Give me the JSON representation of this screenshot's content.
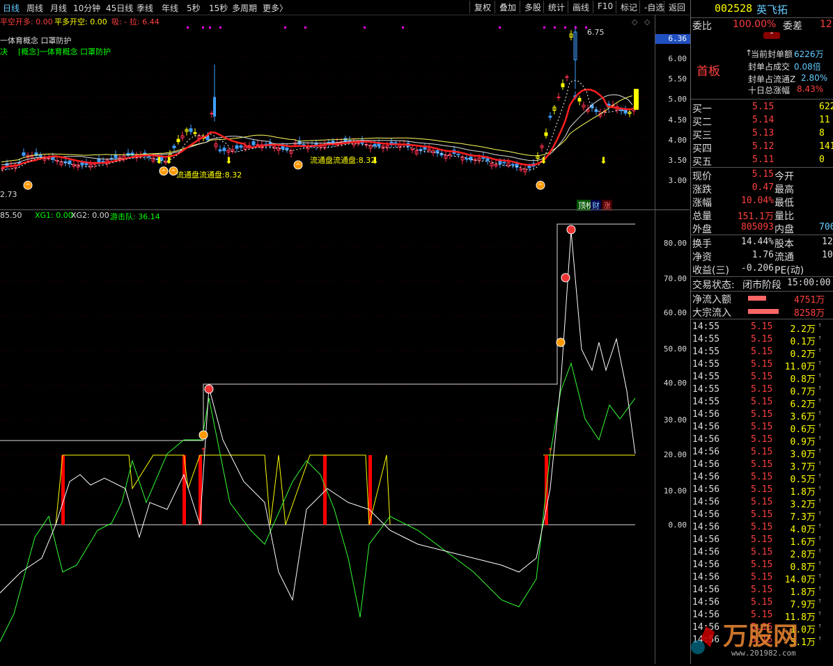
{
  "topbar": {
    "tabs": [
      "日线",
      "周线",
      "月线",
      "10分钟",
      "45日线",
      "季线",
      "年线",
      "5秒",
      "15秒",
      "多周期",
      "更多〉"
    ],
    "buttons": [
      "复权",
      "叠加",
      "多股",
      "统计",
      "画线",
      "F10",
      "标记",
      "-自选",
      "返回"
    ]
  },
  "main_chart": {
    "indicator_line": {
      "label1": "平空开多: 0.00",
      "label2": "平多开空: 0.00",
      "label3": "吸: -",
      "label4": "拉: 6.44"
    },
    "concept1": "一体育概念 口罩防护",
    "concept2_prefix": "决",
    "concept2": "[概念]一体育概念 口罩防护",
    "yticks": [
      "6.36",
      "6.00",
      "5.50",
      "5.00",
      "4.50",
      "4.00",
      "3.50",
      "3.00"
    ],
    "high_label": "6.75",
    "low_label": "2.73",
    "annot1": "流通盘流通盘:8.32",
    "annot2": "流通盘流通盘:8.32",
    "badges": [
      "顶榜",
      "财",
      "涨"
    ]
  },
  "sub_chart": {
    "indicator": {
      "v1": "85.50",
      "xg1": "XG1: 0.00",
      "xg2": "XG2: 0.00",
      "yjd": "游击队: 36.14"
    },
    "yticks": [
      "80.00",
      "70.00",
      "60.00",
      "50.00",
      "40.00",
      "30.00",
      "20.00",
      "10.00",
      "0.00"
    ]
  },
  "chart_data": {
    "type": "line",
    "title": "",
    "price_range": [
      2.73,
      6.75
    ],
    "indicator_range": [
      0,
      85.5
    ],
    "last_values": {
      "price": 5.15,
      "indicator": 36.14
    }
  },
  "stock": {
    "code": "002528",
    "name": "英飞拓",
    "weibi_label": "委比",
    "weibi_value": "100.00%",
    "weicha_label": "委差",
    "weicha_value": "12",
    "board_label": "首板",
    "seal_info": [
      {
        "label": "当前封单额",
        "value": "6226万"
      },
      {
        "label": "封单占成交",
        "value": "0.08倍"
      },
      {
        "label": "封单占流通Z",
        "value": "2.80%"
      },
      {
        "label": "十日总涨幅",
        "value": "8.43%"
      }
    ],
    "bids": [
      {
        "label": "买一",
        "price": "5.15",
        "vol": "622"
      },
      {
        "label": "买二",
        "price": "5.14",
        "vol": "11"
      },
      {
        "label": "买三",
        "price": "5.13",
        "vol": "8"
      },
      {
        "label": "买四",
        "price": "5.12",
        "vol": "141"
      },
      {
        "label": "买五",
        "price": "5.11",
        "vol": "0"
      }
    ],
    "quote": [
      {
        "l1": "现价",
        "v1": "5.15",
        "l2": "今开",
        "v2": ""
      },
      {
        "l1": "涨跌",
        "v1": "0.47",
        "l2": "最高",
        "v2": ""
      },
      {
        "l1": "涨幅",
        "v1": "10.04%",
        "l2": "最低",
        "v2": ""
      },
      {
        "l1": "总量",
        "v1": "151.1万",
        "l2": "量比",
        "v2": ""
      },
      {
        "l1": "外盘",
        "v1": "805093",
        "l2": "内盘",
        "v2": "706"
      }
    ],
    "finance": [
      {
        "l1": "换手",
        "v1": "14.44%",
        "l2": "股本",
        "v2": "12"
      },
      {
        "l1": "净资",
        "v1": "1.76",
        "l2": "流通",
        "v2": "10"
      },
      {
        "l1": "收益(三)",
        "v1": "-0.206",
        "l2": "PE(动)",
        "v2": ""
      }
    ],
    "status_label": "交易状态:",
    "status_value": "闭市阶段",
    "status_time": "15:00:00",
    "flows": [
      {
        "label": "净流入额",
        "value": "4751万",
        "level": 0.6
      },
      {
        "label": "大宗流入",
        "value": "8258万",
        "level": 1.0
      }
    ],
    "ticks": [
      {
        "t": "14:55",
        "p": "5.15",
        "v": "2.2万"
      },
      {
        "t": "14:55",
        "p": "5.15",
        "v": "0.1万"
      },
      {
        "t": "14:55",
        "p": "5.15",
        "v": "0.2万"
      },
      {
        "t": "14:55",
        "p": "5.15",
        "v": "11.0万"
      },
      {
        "t": "14:55",
        "p": "5.15",
        "v": "0.8万"
      },
      {
        "t": "14:55",
        "p": "5.15",
        "v": "0.7万"
      },
      {
        "t": "14:55",
        "p": "5.15",
        "v": "6.2万"
      },
      {
        "t": "14:56",
        "p": "5.15",
        "v": "3.6万"
      },
      {
        "t": "14:56",
        "p": "5.15",
        "v": "0.6万"
      },
      {
        "t": "14:56",
        "p": "5.15",
        "v": "0.9万"
      },
      {
        "t": "14:56",
        "p": "5.15",
        "v": "3.0万"
      },
      {
        "t": "14:56",
        "p": "5.15",
        "v": "3.7万"
      },
      {
        "t": "14:56",
        "p": "5.15",
        "v": "0.5万"
      },
      {
        "t": "14:56",
        "p": "5.15",
        "v": "1.8万"
      },
      {
        "t": "14:56",
        "p": "5.15",
        "v": "3.2万"
      },
      {
        "t": "14:56",
        "p": "5.15",
        "v": "7.3万"
      },
      {
        "t": "14:56",
        "p": "5.15",
        "v": "4.0万"
      },
      {
        "t": "14:56",
        "p": "5.15",
        "v": "1.6万"
      },
      {
        "t": "14:56",
        "p": "5.15",
        "v": "2.8万"
      },
      {
        "t": "14:56",
        "p": "5.15",
        "v": "0.8万"
      },
      {
        "t": "14:56",
        "p": "5.15",
        "v": "14.0万"
      },
      {
        "t": "14:56",
        "p": "5.15",
        "v": "1.8万"
      },
      {
        "t": "14:56",
        "p": "5.15",
        "v": "7.9万"
      },
      {
        "t": "14:56",
        "p": "5.15",
        "v": "11.8万"
      },
      {
        "t": "14:56",
        "p": "5.15",
        "v": "1.0万"
      },
      {
        "t": "14:56",
        "p": "5.15",
        "v": "3.1万"
      }
    ],
    "watermark": "万股网",
    "watermark_url": "www.201982.com"
  }
}
